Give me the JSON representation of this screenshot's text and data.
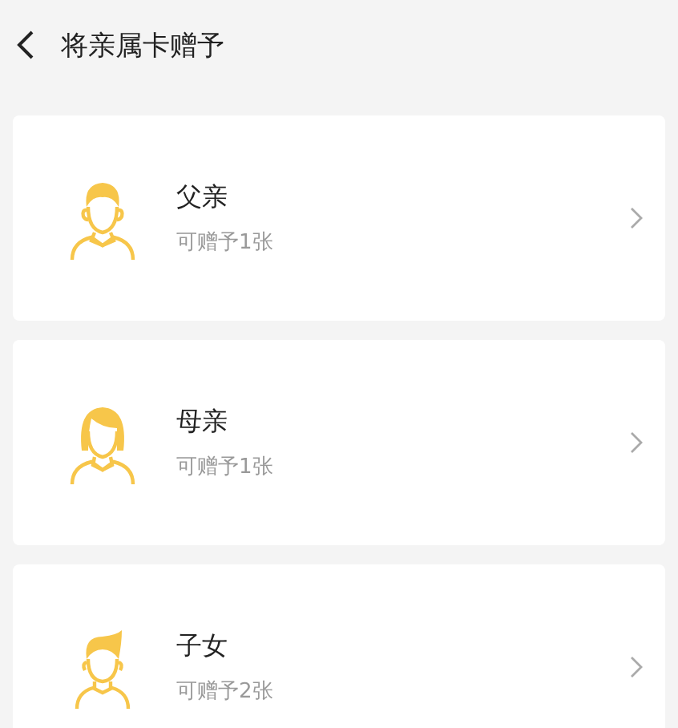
{
  "header": {
    "title": "将亲属卡赠予"
  },
  "members": [
    {
      "kind": "father",
      "name": "父亲",
      "quota": "可赠予1张"
    },
    {
      "kind": "mother",
      "name": "母亲",
      "quota": "可赠予1张"
    },
    {
      "kind": "child",
      "name": "子女",
      "quota": "可赠予2张"
    }
  ]
}
